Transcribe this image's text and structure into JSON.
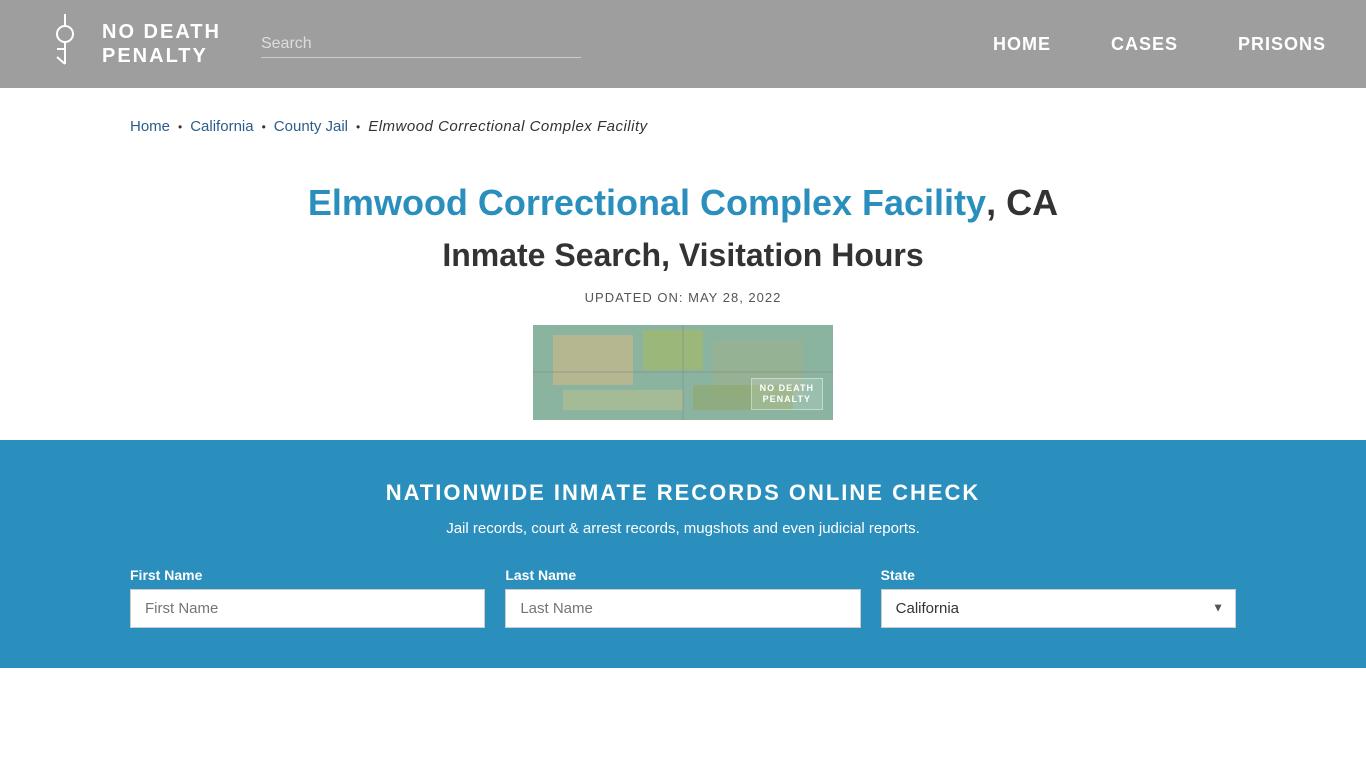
{
  "header": {
    "logo_line1": "NO DEATH",
    "logo_line2": "PENALTY",
    "search_placeholder": "Search",
    "nav": {
      "home": "HOME",
      "cases": "CASES",
      "prisons": "PRISONS"
    }
  },
  "breadcrumb": {
    "home": "Home",
    "california": "California",
    "county_jail": "County Jail",
    "current": "Elmwood Correctional Complex Facility"
  },
  "page": {
    "title_highlight": "Elmwood Correctional Complex Facility",
    "title_rest": ", CA",
    "subtitle": "Inmate Search, Visitation Hours",
    "updated_label": "UPDATED ON: MAY 28, 2022"
  },
  "records": {
    "title": "NATIONWIDE INMATE RECORDS ONLINE CHECK",
    "subtitle": "Jail records, court & arrest records, mugshots and even judicial reports.",
    "form": {
      "first_name_label": "First Name",
      "first_name_placeholder": "First Name",
      "last_name_label": "Last Name",
      "last_name_placeholder": "Last Name",
      "state_label": "State",
      "state_default": "California"
    }
  },
  "facility_image": {
    "logo_text_line1": "NO DEATH",
    "logo_text_line2": "PENALTY"
  }
}
